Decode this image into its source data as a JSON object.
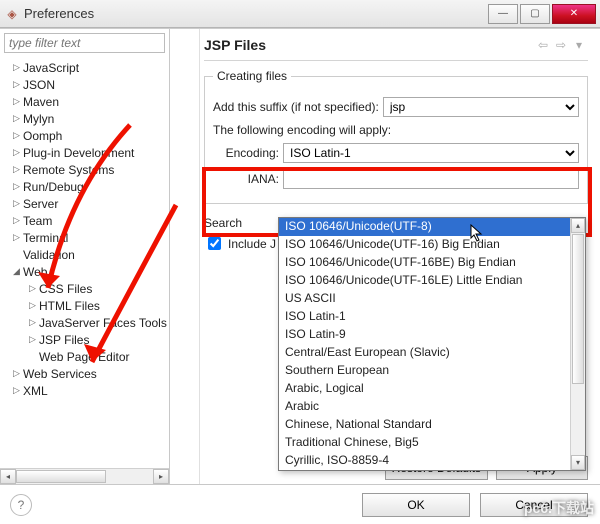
{
  "window": {
    "title": "Preferences"
  },
  "filter": {
    "placeholder": "type filter text"
  },
  "tree": {
    "items": [
      {
        "label": "JavaScript",
        "expand": "right"
      },
      {
        "label": "JSON",
        "expand": "right"
      },
      {
        "label": "Maven",
        "expand": "right"
      },
      {
        "label": "Mylyn",
        "expand": "right"
      },
      {
        "label": "Oomph",
        "expand": "right"
      },
      {
        "label": "Plug-in Development",
        "expand": "right"
      },
      {
        "label": "Remote Systems",
        "expand": "right"
      },
      {
        "label": "Run/Debug",
        "expand": "right"
      },
      {
        "label": "Server",
        "expand": "right"
      },
      {
        "label": "Team",
        "expand": "right"
      },
      {
        "label": "Terminal",
        "expand": "right"
      },
      {
        "label": "Validation",
        "expand": "none"
      },
      {
        "label": "Web",
        "expand": "down"
      }
    ],
    "web_children": [
      {
        "label": "CSS Files",
        "expand": "right"
      },
      {
        "label": "HTML Files",
        "expand": "right"
      },
      {
        "label": "JavaServer Faces Tools",
        "expand": "right"
      },
      {
        "label": "JSP Files",
        "expand": "right"
      },
      {
        "label": "Web Page Editor",
        "expand": "none"
      }
    ],
    "tail": [
      {
        "label": "Web Services",
        "expand": "right"
      },
      {
        "label": "XML",
        "expand": "right"
      }
    ]
  },
  "page": {
    "heading": "JSP Files",
    "fieldset_legend": "Creating files",
    "suffix_label": "Add this suffix (if not specified):",
    "suffix_value": "jsp",
    "apply_text": "The following encoding will apply:",
    "encoding_label": "Encoding:",
    "encoding_value": "ISO Latin-1",
    "iana_label": "IANA:",
    "search_legend": "Search",
    "include_label": "Include JSP matches in Java searches",
    "dropdown_options": [
      "ISO 10646/Unicode(UTF-8)",
      "ISO 10646/Unicode(UTF-16) Big Endian",
      "ISO 10646/Unicode(UTF-16BE) Big Endian",
      "ISO 10646/Unicode(UTF-16LE) Little Endian",
      "US ASCII",
      "ISO Latin-1",
      "ISO Latin-9",
      "Central/East European (Slavic)",
      "Southern European",
      "Arabic, Logical",
      "Arabic",
      "Chinese, National Standard",
      "Traditional Chinese, Big5",
      "Cyrillic, ISO-8859-4"
    ],
    "restore_btn": "Restore Defaults",
    "apply_btn": "Apply",
    "ok_btn": "OK",
    "cancel_btn": "Cancel"
  },
  "watermark": "pc6.下载站"
}
